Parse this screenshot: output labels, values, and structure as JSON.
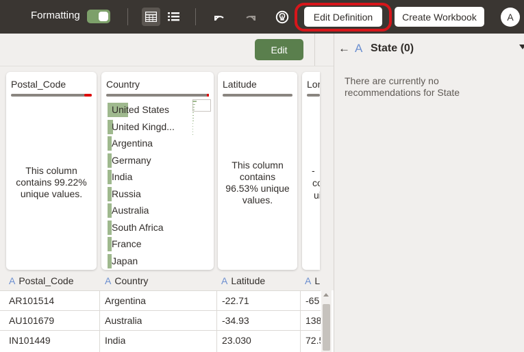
{
  "toolbar": {
    "formatting_label": "Formatting",
    "formatting_on": true,
    "edit_definition_label": "Edit Definition",
    "create_workbook_label": "Create Workbook",
    "avatar_initial": "A"
  },
  "main": {
    "edit_label": "Edit"
  },
  "cards": {
    "postal": {
      "title": "Postal_Code",
      "message": "This column contains 99.22% unique values."
    },
    "country": {
      "title": "Country",
      "items": [
        {
          "label": "United States",
          "share": 0.24
        },
        {
          "label": "United Kingd...",
          "share": 0.06
        },
        {
          "label": "Argentina",
          "share": 0.04
        },
        {
          "label": "Germany",
          "share": 0.035
        },
        {
          "label": "India",
          "share": 0.03
        },
        {
          "label": "Russia",
          "share": 0.03
        },
        {
          "label": "Australia",
          "share": 0.03
        },
        {
          "label": "South Africa",
          "share": 0.03
        },
        {
          "label": "France",
          "share": 0.03
        },
        {
          "label": "Japan",
          "share": 0.03
        }
      ]
    },
    "latitude": {
      "title": "Latitude",
      "message": "This column contains 96.53% unique values."
    },
    "longitude": {
      "title": "Lon",
      "message_fragments": [
        "-",
        "co",
        "ui"
      ]
    }
  },
  "columns": [
    {
      "name": "Postal_Code"
    },
    {
      "name": "Country"
    },
    {
      "name": "Latitude"
    },
    {
      "name": "L"
    }
  ],
  "rows": [
    [
      "AR101514",
      "Argentina",
      "-22.71",
      "-65"
    ],
    [
      "AU101679",
      "Australia",
      "-34.93",
      "138"
    ],
    [
      "IN101449",
      "India",
      "23.030",
      "72.5"
    ]
  ],
  "panel": {
    "back_arrow": "←",
    "type_icon": "A",
    "title": "State (0)",
    "message": "There are currently no recommendations for State"
  },
  "colors": {
    "toolbar_bg": "#3a3632",
    "accent_green": "#5a7f4d",
    "highlight_red": "#d7161b",
    "type_icon_blue": "#6c8fd0",
    "bar_green": "#9fb98e"
  }
}
